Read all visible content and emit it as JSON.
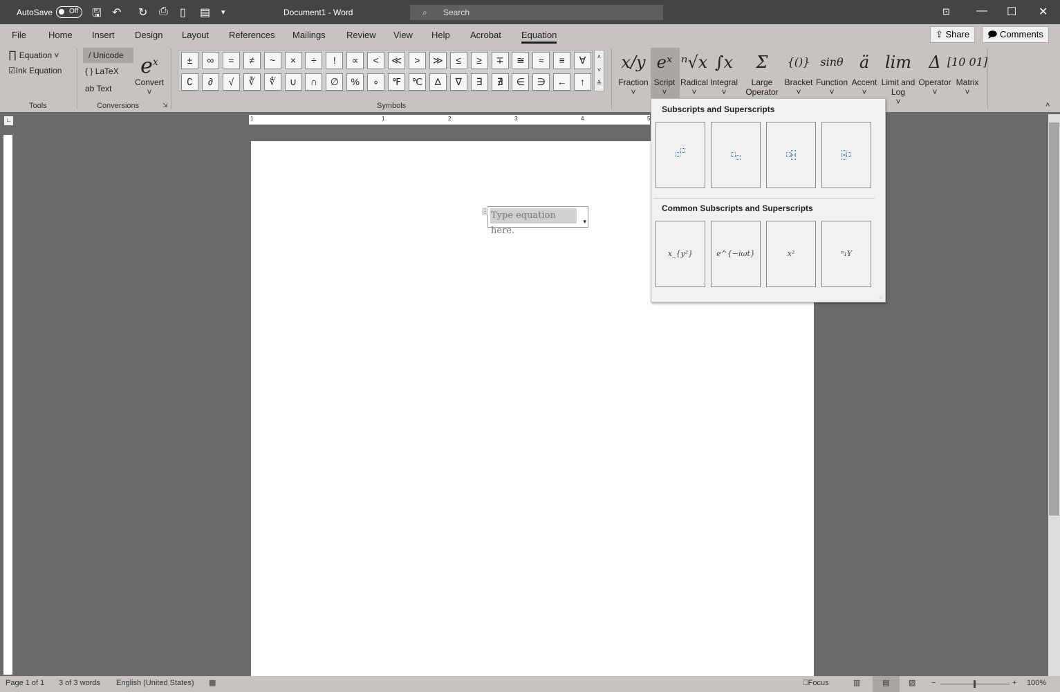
{
  "titlebar": {
    "autosave_label": "AutoSave",
    "autosave_state": "Off",
    "title": "Document1  -  Word",
    "search_placeholder": "Search"
  },
  "tabs": [
    "File",
    "Home",
    "Insert",
    "Design",
    "Layout",
    "References",
    "Mailings",
    "Review",
    "View",
    "Help",
    "Acrobat",
    "Equation"
  ],
  "active_tab": "Equation",
  "share_label": "Share",
  "comments_label": "Comments",
  "tools": {
    "equation": "Equation",
    "ink_equation": "Ink Equation",
    "group": "Tools"
  },
  "conversions": {
    "unicode": "Unicode",
    "latex": "LaTeX",
    "text": "Text",
    "convert": "Convert",
    "group": "Conversions"
  },
  "symbols": {
    "group": "Symbols",
    "row1": [
      "±",
      "∞",
      "=",
      "≠",
      "~",
      "×",
      "÷",
      "!",
      "∝",
      "<",
      "≪",
      ">",
      "≫",
      "≤",
      "≥",
      "∓",
      "≅",
      "≈",
      "≡",
      "∀"
    ],
    "row2": [
      "∁",
      "∂",
      "√",
      "∛",
      "∜",
      "∪",
      "∩",
      "∅",
      "%",
      "∘",
      "℉",
      "℃",
      "∆",
      "∇",
      "∃",
      "∄",
      "∈",
      "∋",
      "←",
      "↑"
    ]
  },
  "structures": [
    {
      "label": "Fraction",
      "glyph": "x/y"
    },
    {
      "label": "Script",
      "glyph": "eˣ"
    },
    {
      "label": "Radical",
      "glyph": "ⁿ√x"
    },
    {
      "label": "Integral",
      "glyph": "∫x"
    },
    {
      "label": "Large Operator",
      "glyph": "Σ"
    },
    {
      "label": "Bracket",
      "glyph": "{()}"
    },
    {
      "label": "Function",
      "glyph": "sinθ"
    },
    {
      "label": "Accent",
      "glyph": "ä"
    },
    {
      "label": "Limit and Log",
      "glyph": "lim"
    },
    {
      "label": "Operator",
      "glyph": "Δ"
    },
    {
      "label": "Matrix",
      "glyph": "[10 01]"
    }
  ],
  "dropdown": {
    "section1": "Subscripts and Superscripts",
    "section2": "Common Subscripts and Superscripts",
    "common": [
      "x_{y²}",
      "e^{−iωt}",
      "x²",
      "ⁿ₁Y"
    ]
  },
  "document": {
    "equation_placeholder": "Type equation here."
  },
  "ruler_numbers": [
    "1",
    "1",
    "2",
    "3",
    "4",
    "5"
  ],
  "status": {
    "page": "Page 1 of 1",
    "words": "3 of 3 words",
    "language": "English (United States)",
    "focus": "Focus",
    "zoom": "100%"
  },
  "colors": {
    "titlebar": "#444444",
    "ribbon": "#c6c3c0",
    "canvas": "#6a6a6a",
    "placeholder_box": "#3a7bc8"
  }
}
